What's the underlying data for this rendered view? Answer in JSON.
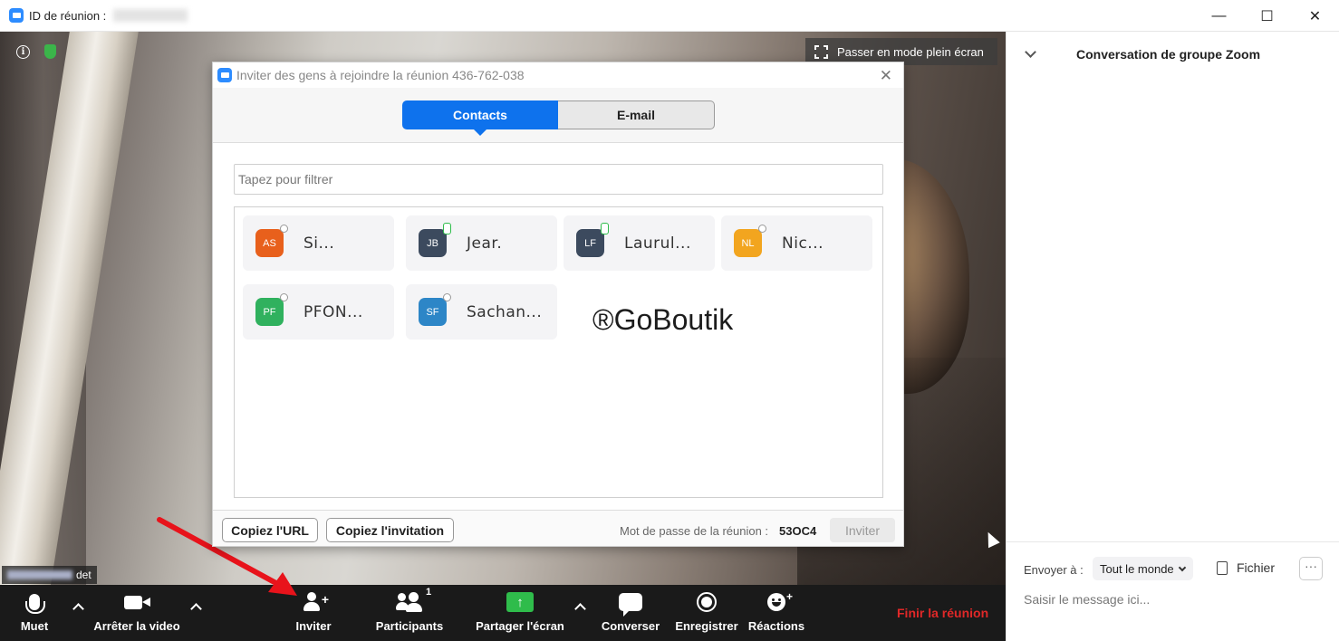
{
  "window": {
    "title": "ID de réunion :",
    "controls": {
      "minimize": "—",
      "maximize": "☐",
      "close": "✕"
    }
  },
  "video": {
    "fullscreen_label": "Passer en mode plein écran",
    "name_tag_suffix": "det"
  },
  "toolbar": {
    "mute": "Muet",
    "stop_video": "Arrêter la video",
    "invite": "Inviter",
    "participants": "Participants",
    "participants_count": "1",
    "share_screen": "Partager l'écran",
    "chat": "Converser",
    "record": "Enregistrer",
    "reactions": "Réactions",
    "end_meeting": "Finir la réunion",
    "end_color": "#e02828"
  },
  "chat_panel": {
    "title": "Conversation de groupe Zoom",
    "send_to_label": "Envoyer à :",
    "send_to_value": "Tout le monde",
    "file_label": "Fichier",
    "more_label": "···",
    "message_placeholder": "Saisir le message ici..."
  },
  "dialog": {
    "title": "Inviter des gens à rejoindre la réunion 436-762-038",
    "close": "✕",
    "tabs": {
      "contacts": "Contacts",
      "email": "E-mail"
    },
    "filter_placeholder": "Tapez pour filtrer",
    "contacts": [
      {
        "initials": "AS",
        "name": "Si...",
        "color": "#e8601c",
        "online": false
      },
      {
        "initials": "JB",
        "name": "Jear.",
        "color": "#3c4a5e",
        "online": true
      },
      {
        "initials": "LF",
        "name": "Laurul...",
        "color": "#3c4a5e",
        "online": true
      },
      {
        "initials": "NL",
        "name": "Nic...",
        "color": "#f2a51f",
        "online": false
      },
      {
        "initials": "PF",
        "name": "PFON...",
        "color": "#30b15e",
        "online": false
      },
      {
        "initials": "SF",
        "name": "Sachan...",
        "color": "#2d86c7",
        "online": false
      }
    ],
    "watermark": "®GoBoutik",
    "copy_url": "Copiez l'URL",
    "copy_invitation": "Copiez l'invitation",
    "password_label": "Mot de passe de la réunion :",
    "password_value": "53OC4",
    "invite_button": "Inviter"
  },
  "accent_color": "#0e72ed"
}
